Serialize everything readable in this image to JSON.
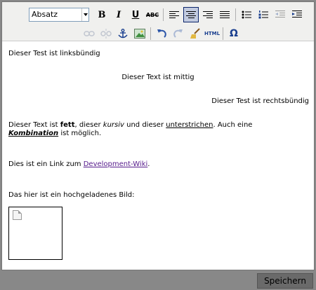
{
  "toolbar": {
    "format_select": {
      "value": "Absatz"
    },
    "buttons_row1": [
      {
        "name": "bold-button",
        "glyph": "B"
      },
      {
        "name": "italic-button",
        "glyph": "I"
      },
      {
        "name": "underline-button",
        "glyph": "U"
      },
      {
        "name": "strikethrough-button",
        "glyph": "ABC"
      }
    ],
    "html_label": "HTML",
    "omega_label": "Ω",
    "active_alignment": "center"
  },
  "content": {
    "p1": "Dieser Test ist linksbündig",
    "p2": "Dieser Text ist mittig",
    "p3": "Dieser Test ist rechtsbündig",
    "p4": {
      "a": "Dieser Text ist ",
      "bold": "fett",
      "b": ", dieser ",
      "italic": "kursiv",
      "c": " und dieser ",
      "underline": "unterstrichen",
      "d": ". Auch eine ",
      "combo": "Kombination",
      "e": " ist möglich."
    },
    "p5": {
      "a": "Dies ist ein Link zum ",
      "link": "Development-Wiki",
      "b": "."
    },
    "p6": "Das hier ist ein hochgeladenes Bild:"
  },
  "footer": {
    "save_label": "Speichern"
  },
  "colors": {
    "link": "#551a8b",
    "toolbar_bg": "#f0f0ee",
    "frame": "#888888"
  }
}
